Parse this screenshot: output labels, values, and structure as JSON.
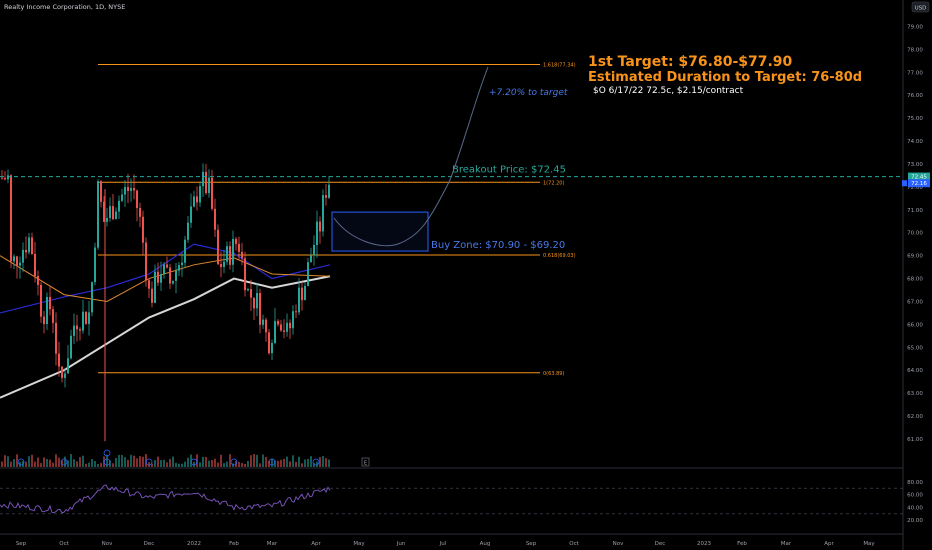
{
  "header": {
    "title": "Realty Income Corporation, 1D, NYSE"
  },
  "currency": "USD",
  "colors": {
    "bg": "#000000",
    "up": "#26a69a",
    "down": "#ef5350",
    "fib": "#f7931a",
    "buy_zone": "#2962ff",
    "ma_white": "#d6d6d6",
    "ma_blue": "#2a2ad6",
    "ma_orange": "#e08a2c",
    "breakout": "#26a69a",
    "target_text": "#f7931a",
    "rsi": "#7e57c2",
    "annotation_blue": "#4a78e8",
    "grid_text": "#9ba0a8"
  },
  "annotations": {
    "target_title": "1st Target: $76.80-$77.90",
    "duration_title": "Estimated Duration to Target: 76-80d",
    "contract_note": "$O 6/17/22 72.5c, $2.15/contract",
    "pct_to_target": "+7.20% to target",
    "breakout_label": "Breakout Price: $72.45",
    "buy_zone_label": "Buy Zone: $70.90 - $69.20"
  },
  "fib_levels": [
    {
      "label": "1.618(77.34)",
      "value": 77.34
    },
    {
      "label": "1(72.20)",
      "value": 72.2
    },
    {
      "label": "0.618(69.03)",
      "value": 69.03
    },
    {
      "label": "0(63.89)",
      "value": 63.89
    }
  ],
  "price_badges": [
    {
      "text": "72.45",
      "value": 72.45,
      "color": "#26a69a"
    },
    {
      "text": "72.16",
      "value": 72.16,
      "color": "#2962ff"
    }
  ],
  "chart_data": {
    "type": "candlestick",
    "title": "Realty Income Corporation, 1D, NYSE",
    "y_axis": {
      "ticks": [
        61,
        62,
        63,
        64,
        65,
        66,
        67,
        68,
        69,
        70,
        71,
        72,
        73,
        74,
        75,
        76,
        77,
        78,
        79
      ],
      "range": [
        60.45,
        79.6
      ]
    },
    "x_axis": {
      "ticks": [
        "Sep",
        "Oct",
        "Nov",
        "Dec",
        "2022",
        "Feb",
        "Mar",
        "Apr",
        "May",
        "Jun",
        "Jul",
        "Aug",
        "Sep",
        "Oct",
        "Nov",
        "Dec",
        "2023",
        "Feb",
        "Mar",
        "Apr",
        "May"
      ]
    },
    "price_path": [
      [
        "Sep",
        69.8
      ],
      [
        "Oct",
        64.0
      ],
      [
        "Nov",
        71.6
      ],
      [
        "Dec",
        67.0
      ],
      [
        "2022",
        72.2
      ],
      [
        "Feb",
        67.5
      ],
      [
        "Mar",
        65.0
      ],
      [
        "Apr",
        72.3
      ]
    ],
    "moving_averages": [
      {
        "name": "MA-white",
        "values": [
          [
            "Sep",
            62.8
          ],
          [
            "Oct",
            64.0
          ],
          [
            "Dec",
            66.3
          ],
          [
            "2022",
            67.1
          ],
          [
            "Feb",
            68.0
          ],
          [
            "Mar",
            67.6
          ],
          [
            "Apr",
            68.1
          ]
        ]
      },
      {
        "name": "MA-blue",
        "values": [
          [
            "Sep",
            66.5
          ],
          [
            "Oct",
            67.2
          ],
          [
            "Nov",
            67.6
          ],
          [
            "Dec",
            68.2
          ],
          [
            "2022",
            69.5
          ],
          [
            "Feb",
            69.1
          ],
          [
            "Mar",
            68.0
          ],
          [
            "Apr",
            68.6
          ]
        ]
      },
      {
        "name": "MA-orange",
        "values": [
          [
            "Sep",
            69.0
          ],
          [
            "Oct",
            67.3
          ],
          [
            "Nov",
            67.0
          ],
          [
            "Dec",
            68.0
          ],
          [
            "2022",
            68.6
          ],
          [
            "Feb",
            68.9
          ],
          [
            "Mar",
            68.2
          ],
          [
            "Apr",
            68.1
          ]
        ]
      }
    ],
    "breakout_price": 72.45,
    "last_price": 72.16,
    "buy_zone": [
      69.2,
      70.9
    ],
    "target_range": [
      76.8,
      77.9
    ],
    "rsi": {
      "ticks": [
        20,
        40,
        60,
        80
      ],
      "levels": [
        30,
        70
      ],
      "values": [
        [
          "Sep",
          45
        ],
        [
          "Oct",
          35
        ],
        [
          "Nov",
          72
        ],
        [
          "Dec",
          55
        ],
        [
          "2022",
          65
        ],
        [
          "Feb",
          40
        ],
        [
          "Mar",
          42
        ],
        [
          "Apr",
          70
        ]
      ]
    }
  }
}
